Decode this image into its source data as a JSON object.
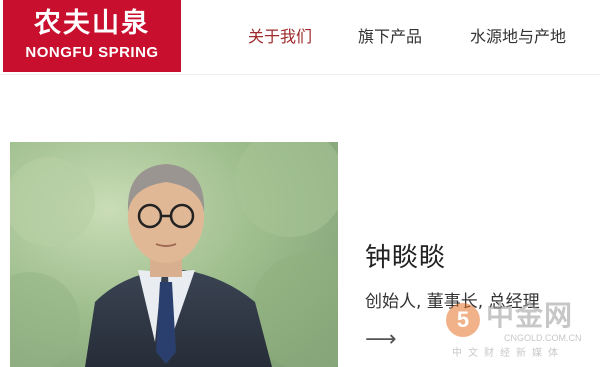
{
  "brand": {
    "name_cn": "农夫山泉",
    "name_en": "NONGFU SPRING",
    "color": "#c8102e"
  },
  "nav": [
    {
      "label": "关于我们",
      "active": true
    },
    {
      "label": "旗下产品",
      "active": false
    },
    {
      "label": "水源地与产地",
      "active": false
    }
  ],
  "profile": {
    "name": "钟睒睒",
    "title": "创始人, 董事长, 总经理",
    "arrow_icon": "arrow-right-icon"
  },
  "watermark": {
    "main": "中金网",
    "url": "CNGOLD.COM.CN",
    "sub": "中文财经新媒体",
    "badge": "5"
  },
  "colors": {
    "active_nav": "#9e2a2b",
    "text": "#333333"
  }
}
